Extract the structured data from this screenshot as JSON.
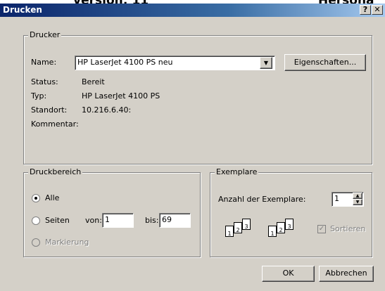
{
  "background": {
    "left_text": "version: 11",
    "right_text": "Hersona"
  },
  "dialog": {
    "title": "Drucken",
    "help_label": "?",
    "close_label": "✕"
  },
  "printer": {
    "group_label": "Drucker",
    "name_label": "Name:",
    "name_value": "HP LaserJet 4100 PS neu",
    "properties_button": "Eigenschaften...",
    "status_label": "Status:",
    "status_value": "Bereit",
    "type_label": "Typ:",
    "type_value": "HP LaserJet 4100 PS",
    "location_label": "Standort:",
    "location_value": "10.216.6.40:",
    "comment_label": "Kommentar:"
  },
  "range": {
    "group_label": "Druckbereich",
    "all_label": "Alle",
    "pages_label": "Seiten",
    "from_label": "von:",
    "from_value": "1",
    "to_label": "bis:",
    "to_value": "69",
    "selection_label": "Markierung"
  },
  "copies": {
    "group_label": "Exemplare",
    "count_label": "Anzahl der Exemplare:",
    "count_value": "1",
    "collate_label": "Sortieren",
    "collate_checkmark": "✓",
    "page_numbers": [
      "1",
      "2",
      "3"
    ]
  },
  "buttons": {
    "ok_label": "OK",
    "cancel_label": "Abbrechen"
  }
}
